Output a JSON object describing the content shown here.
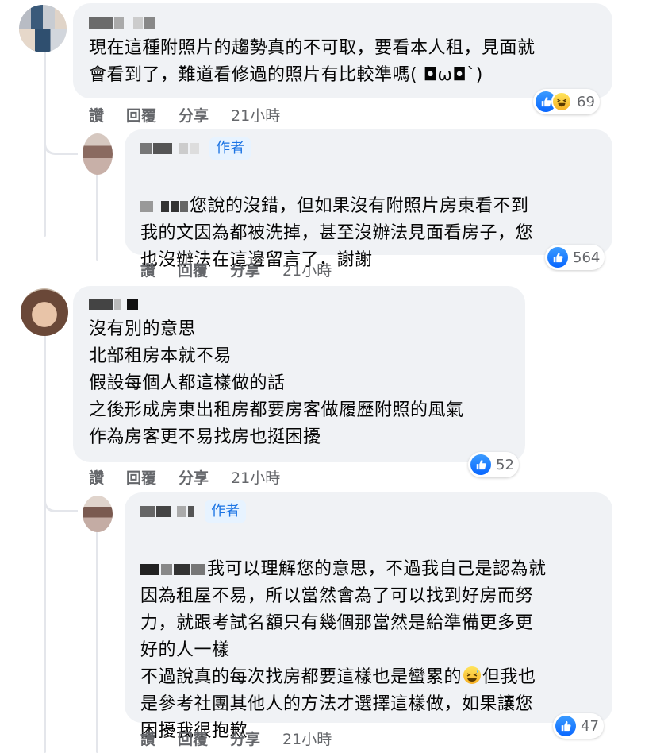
{
  "actions": {
    "like": "讚",
    "reply": "回覆",
    "share": "分享"
  },
  "author_tag": "作者",
  "comments": [
    {
      "text": "現在這種附照片的趨勢真的不可取，要看本人租，見面就\n會看到了，難道看修過的照片有比較準嗎( ◘ω◘`)",
      "time": "21小時",
      "reactions": "69"
    },
    {
      "text": "您說的沒錯，但如果沒有附照片房東看不到\n我的文因為都被洗掉，甚至沒辦法見面看房子，您\n也沒辦法在這邊留言了，謝謝",
      "time": "21小時",
      "reactions": "564"
    },
    {
      "text": "沒有別的意思\n北部租房本就不易\n假設每個人都這樣做的話\n之後形成房東出租房都要房客做履歷附照的風氣\n作為房客更不易找房也挺困擾",
      "time": "21小時",
      "reactions": "52"
    },
    {
      "text_a": "我可以理解您的意思，不過我自己是認為就\n因為租屋不易，所以當然會為了可以找到好房而努\n力，就跟考試名額只有幾個那當然是給準備更多更\n好的人一樣\n不過說真的每次找房都要這樣也是蠻累的",
      "text_b": "但我也\n是參考社團其他人的方法才選擇這樣做，如果讓您\n困擾我很抱歉",
      "time": "21小時",
      "reactions": "47"
    }
  ],
  "colors": {
    "bubble": "#f0f2f5",
    "like_blue": "#0866ff",
    "meta_gray": "#65676b",
    "author_blue": "#1b74e4"
  },
  "icons": {
    "like": "like-reaction-icon",
    "haha": "haha-reaction-icon",
    "emoji": "grinning-sweat-emoji"
  }
}
